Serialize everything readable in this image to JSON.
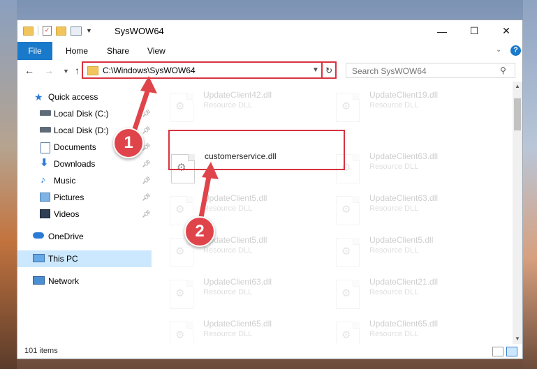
{
  "window": {
    "title": "SysWOW64"
  },
  "titlebar": {
    "minimize_glyph": "—",
    "maximize_glyph": "☐",
    "close_glyph": "✕"
  },
  "ribbon": {
    "tabs": [
      "File",
      "Home",
      "Share",
      "View"
    ],
    "help_glyph": "?"
  },
  "address": {
    "path": "C:\\Windows\\SysWOW64"
  },
  "search": {
    "placeholder": "Search SysWOW64"
  },
  "sidebar": {
    "items": [
      {
        "label": "Quick access",
        "icon": "star-icon"
      },
      {
        "label": "Local Disk (C:)",
        "icon": "drive-icon",
        "pinned": true
      },
      {
        "label": "Local Disk (D:)",
        "icon": "drive-icon",
        "pinned": true
      },
      {
        "label": "Documents",
        "icon": "documents-icon",
        "pinned": true
      },
      {
        "label": "Downloads",
        "icon": "download-icon",
        "pinned": true
      },
      {
        "label": "Music",
        "icon": "music-icon",
        "pinned": true
      },
      {
        "label": "Pictures",
        "icon": "pictures-icon",
        "pinned": true
      },
      {
        "label": "Videos",
        "icon": "videos-icon",
        "pinned": true
      },
      {
        "label": "OneDrive",
        "icon": "cloud-icon"
      },
      {
        "label": "This PC",
        "icon": "computer-icon",
        "selected": true
      },
      {
        "label": "Network",
        "icon": "network-icon"
      }
    ]
  },
  "files": [
    {
      "name": "UpdateClient42.dll",
      "desc": "Resource DLL",
      "faded": true
    },
    {
      "name": "UpdateClient19.dll",
      "desc": "Resource DLL",
      "faded": true
    },
    {
      "name": "customerservice.dll",
      "desc": "",
      "faded": false
    },
    {
      "name": "UpdateClient63.dll",
      "desc": "Resource DLL",
      "faded": true
    },
    {
      "name": "UpdateClient5.dll",
      "desc": "Resource DLL",
      "faded": true
    },
    {
      "name": "UpdateClient63.dll",
      "desc": "Resource DLL",
      "faded": true
    },
    {
      "name": "UpdateClient5.dll",
      "desc": "Resource DLL",
      "faded": true
    },
    {
      "name": "UpdateClient5.dll",
      "desc": "Resource DLL",
      "faded": true
    },
    {
      "name": "UpdateClient63.dll",
      "desc": "Resource DLL",
      "faded": true
    },
    {
      "name": "UpdateClient21.dll",
      "desc": "Resource DLL",
      "faded": true
    },
    {
      "name": "UpdateClient65.dll",
      "desc": "Resource DLL",
      "faded": true
    },
    {
      "name": "UpdateClient65.dll",
      "desc": "Resource DLL",
      "faded": true
    }
  ],
  "status": {
    "items": "101 items"
  },
  "annotations": {
    "step1": "1",
    "step2": "2"
  },
  "colors": {
    "accent": "#1979ca",
    "highlight": "#d9333f",
    "selected": "#cce8ff"
  }
}
